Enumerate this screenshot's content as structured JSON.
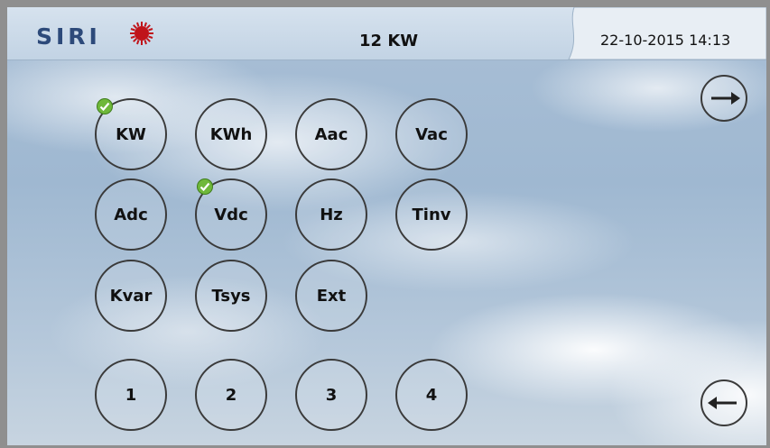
{
  "header": {
    "logo_text": "SIRI",
    "title": "12 KW",
    "datetime": "22-10-2015 14:13"
  },
  "measure_buttons": [
    {
      "label": "KW",
      "checked": true
    },
    {
      "label": "KWh",
      "checked": false
    },
    {
      "label": "Aac",
      "checked": false
    },
    {
      "label": "Vac",
      "checked": false
    },
    {
      "label": "Adc",
      "checked": false
    },
    {
      "label": "Vdc",
      "checked": true
    },
    {
      "label": "Hz",
      "checked": false
    },
    {
      "label": "Tinv",
      "checked": false
    },
    {
      "label": "Kvar",
      "checked": false
    },
    {
      "label": "Tsys",
      "checked": false
    },
    {
      "label": "Ext",
      "checked": false
    }
  ],
  "number_buttons": [
    "1",
    "2",
    "3",
    "4"
  ],
  "nav": {
    "next_icon": "arrow-right-icon",
    "back_icon": "arrow-left-icon"
  },
  "colors": {
    "logo": "#2d4a7a",
    "logo_sun": "#c0141a",
    "check": "#6fb83a",
    "header_bg": "#c2d3e4"
  }
}
